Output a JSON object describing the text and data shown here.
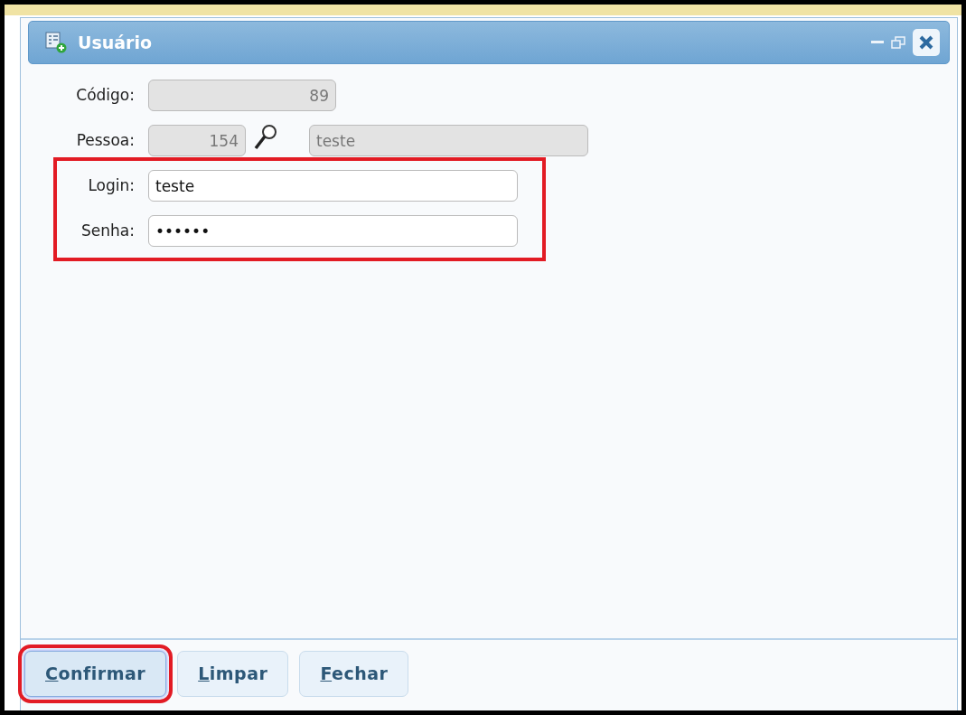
{
  "window": {
    "title": "Usuário"
  },
  "fields": [
    {
      "label": "Código:",
      "kind": "readonly",
      "value": "89"
    },
    {
      "label": "Pessoa:",
      "kind": "lookup",
      "value": "154",
      "description": "teste"
    },
    {
      "label": "Login:",
      "kind": "text",
      "value": "teste",
      "highlighted": true
    },
    {
      "label": "Senha:",
      "kind": "password",
      "value": "••••••",
      "highlighted": true
    }
  ],
  "buttons": [
    {
      "label": "Confirmar",
      "focused": true,
      "highlighted": true
    },
    {
      "label": "Limpar",
      "focused": false,
      "highlighted": false
    },
    {
      "label": "Fechar",
      "focused": false,
      "highlighted": false
    }
  ]
}
